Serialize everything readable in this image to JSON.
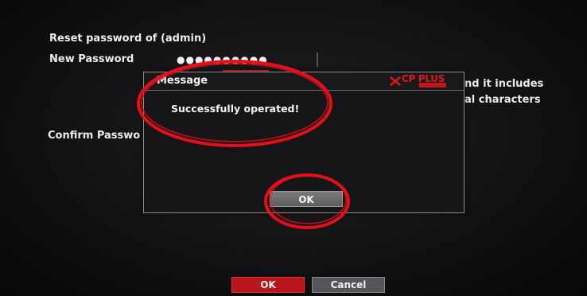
{
  "background_form": {
    "reset_label": "Reset password of (admin)",
    "new_password_label": "New Password",
    "new_password_value": "●●●●●●●●●●",
    "confirm_label": "Confirm Passwo",
    "hint_line1": "nd it includes",
    "hint_line2": "al characters"
  },
  "dialog": {
    "title": "Message",
    "logo_text": "CP PLUS",
    "message": "Successfully operated!",
    "ok_label": "OK"
  },
  "footer": {
    "ok_label": "OK",
    "cancel_label": "Cancel"
  },
  "colors": {
    "annotation": "#e3101a",
    "primary_button": "#b8161c",
    "secondary_button": "#56565a"
  },
  "icons": {
    "cursor": "mouse-pointer-icon",
    "brand": "cp-plus-logo-icon"
  }
}
